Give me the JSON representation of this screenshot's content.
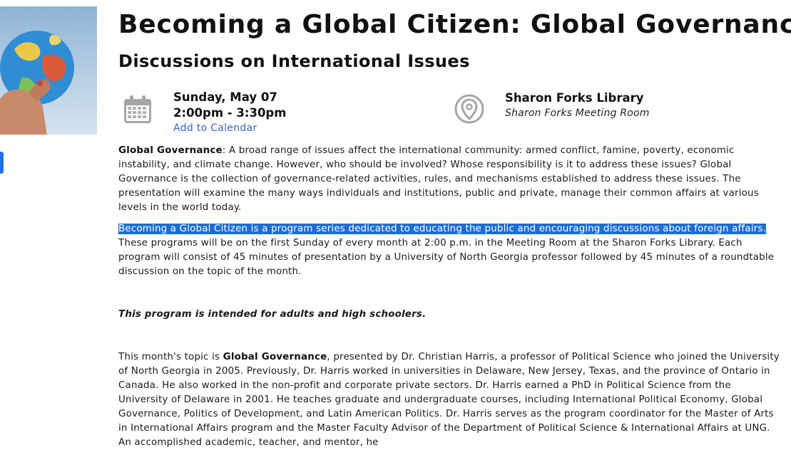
{
  "event": {
    "title": "Becoming a Global Citizen: Global Governance",
    "subtitle": "Discussions on International Issues",
    "date": "Sunday, May 07",
    "time": "2:00pm - 3:30pm",
    "add_to_calendar": "Add to Calendar",
    "location_name": "Sharon Forks Library",
    "location_room": "Sharon Forks Meeting Room"
  },
  "description": {
    "p1_bold": "Global Governance",
    "p1_text": ": A broad range of issues affect the international community: armed conflict, famine, poverty, economic instability, and climate change. However, who should be involved? Whose responsibility is it to address these issues? Global Governance is the collection of governance-related activities, rules, and mechanisms established to address these issues. The presentation will examine the many ways individuals and institutions, public and private, manage their common affairs at various levels in the world today.",
    "p2_selected": "Becoming a Global Citizen is a program series dedicated to educating the public and encouraging discussions about foreign affairs.",
    "p2_text": " These programs will be on the first Sunday of every month at 2:00 p.m. in the Meeting Room at the Sharon Forks Library. Each program will consist of 45 minutes of presentation by a University of North Georgia professor followed by 45 minutes of a roundtable discussion on the topic of the month.",
    "p3_text": "This program is intended for adults and high schoolers.",
    "p4_intro": "This month's topic is ",
    "p4_bold": "Global Governance",
    "p4_text": ", presented by Dr. Christian Harris, a professor of Political Science who joined the University of North Georgia in 2005. Previously, Dr. Harris worked in universities in Delaware, New Jersey, Texas, and the province of Ontario in Canada. He also worked in the non-profit and corporate private sectors. Dr. Harris earned a PhD in Political Science from the University of Delaware in 2001. He teaches graduate and undergraduate courses, including International Political Economy, Global Governance, Politics of Development, and Latin American Politics. Dr. Harris serves as the program coordinator for the Master of Arts in International Affairs program and the Master Faculty Advisor of the Department of Political Science & International Affairs at UNG. An accomplished academic, teacher, and mentor, he"
  },
  "icons": {
    "calendar": "calendar-icon",
    "location": "map-pin-icon"
  },
  "colors": {
    "link": "#3e63c5",
    "selection": "#1c6ed4",
    "icon_gray": "#9a9a9a"
  }
}
